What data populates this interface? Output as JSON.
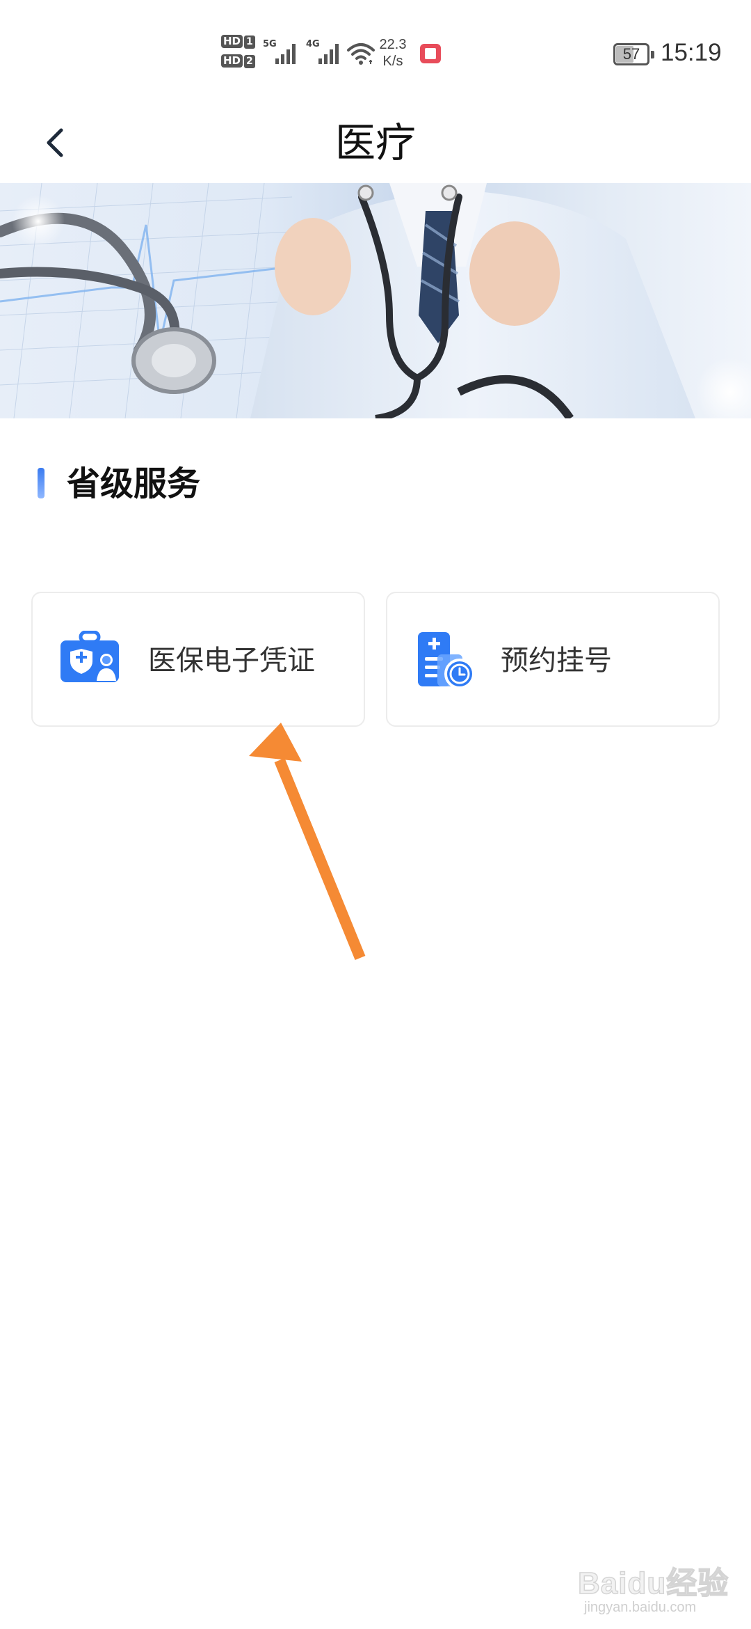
{
  "status_bar": {
    "sim1_label": "HD",
    "sim1_index": "1",
    "sim2_label": "HD",
    "sim2_index": "2",
    "net1_label": "5G",
    "net2_label": "4G",
    "speed_value": "22.3",
    "speed_unit": "K/s",
    "battery_level": "57",
    "battery_fraction": 0.57,
    "time": "15:19",
    "icons": [
      "signal-icon",
      "wifi-icon",
      "book-app-icon",
      "battery-icon"
    ]
  },
  "header": {
    "title": "医疗",
    "back_icon": "chevron-left-icon"
  },
  "banner": {
    "description_icon": "doctor-stethoscope-image"
  },
  "section": {
    "title": "省级服务"
  },
  "services": [
    {
      "label": "医保电子凭证",
      "icon": "medical-insurance-card-icon"
    },
    {
      "label": "预约挂号",
      "icon": "appointment-clock-icon"
    }
  ],
  "annotation": {
    "arrow_color": "#f58a34"
  },
  "watermark": {
    "text": "Baidu经验",
    "url": "jingyan.baidu.com"
  },
  "colors": {
    "accent_blue": "#2f7bf5",
    "text_dark": "#111111",
    "card_border": "#ececec"
  }
}
